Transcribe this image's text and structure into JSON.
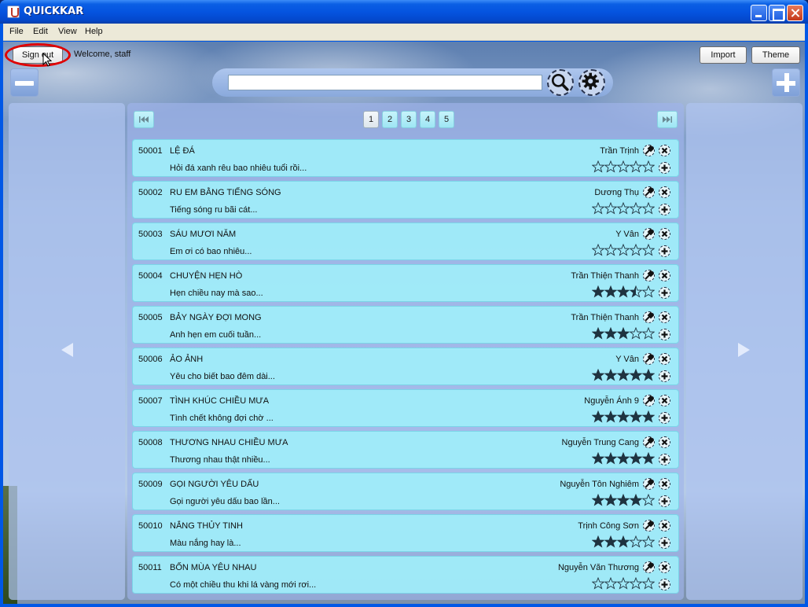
{
  "window": {
    "title": "QUICKKAR"
  },
  "menu": [
    "File",
    "Edit",
    "View",
    "Help"
  ],
  "toolbar": {
    "signout_label": "Sign out",
    "welcome_text": "Welcome, staff",
    "import_label": "Import",
    "theme_label": "Theme"
  },
  "search": {
    "value": "",
    "placeholder": ""
  },
  "pager": {
    "pages": [
      "1",
      "2",
      "3",
      "4",
      "5"
    ],
    "current": "1"
  },
  "colors": {
    "row_bg": "#a0eefa",
    "accent": "#0058e6",
    "highlight_ring": "#e00000"
  },
  "songs": [
    {
      "id": "50001",
      "title": "LỆ ĐÁ",
      "lyric": "Hỏi đá xanh rêu bao nhiêu tuổi rồi...",
      "artist": "Trần Trịnh",
      "rating": 0
    },
    {
      "id": "50002",
      "title": "RU EM BẰNG TIẾNG SÓNG",
      "lyric": "Tiếng sóng ru bãi cát...",
      "artist": "Dương Thụ",
      "rating": 0
    },
    {
      "id": "50003",
      "title": "SÁU MƯƠI NĂM",
      "lyric": "Em ơi có bao nhiêu...",
      "artist": "Y Vân",
      "rating": 0
    },
    {
      "id": "50004",
      "title": "CHUYỆN HẸN HÒ",
      "lyric": "Hẹn chiều nay mà sao...",
      "artist": "Trần Thiện Thanh",
      "rating": 3.5
    },
    {
      "id": "50005",
      "title": "BẢY NGÀY ĐỢI MONG",
      "lyric": "Anh hẹn em cuối tuần...",
      "artist": "Trần Thiện Thanh",
      "rating": 3
    },
    {
      "id": "50006",
      "title": "ẢO ẢNH",
      "lyric": "Yêu cho biết bao đêm dài...",
      "artist": "Y Vân",
      "rating": 5
    },
    {
      "id": "50007",
      "title": "TÌNH KHÚC CHIỀU MƯA",
      "lyric": "Tình chết không đợi chờ ...",
      "artist": "Nguyễn Ánh 9",
      "rating": 5
    },
    {
      "id": "50008",
      "title": "THƯƠNG NHAU CHIỀU MƯA",
      "lyric": "Thương nhau thật nhiều...",
      "artist": "Nguyễn Trung Cang",
      "rating": 5
    },
    {
      "id": "50009",
      "title": "GỌI NGƯỜI YÊU DẤU",
      "lyric": "Gọi người yêu dấu bao lần...",
      "artist": "Nguyễn Tôn Nghiêm",
      "rating": 4
    },
    {
      "id": "50010",
      "title": "NẮNG THỦY TINH",
      "lyric": "Màu nắng hay là...",
      "artist": "Trịnh Công Sơn",
      "rating": 3
    },
    {
      "id": "50011",
      "title": "BỐN MÙA YÊU NHAU",
      "lyric": "Có một chiều thu khi lá vàng mới rơi...",
      "artist": "Nguyễn Văn Thương",
      "rating": 0
    }
  ]
}
